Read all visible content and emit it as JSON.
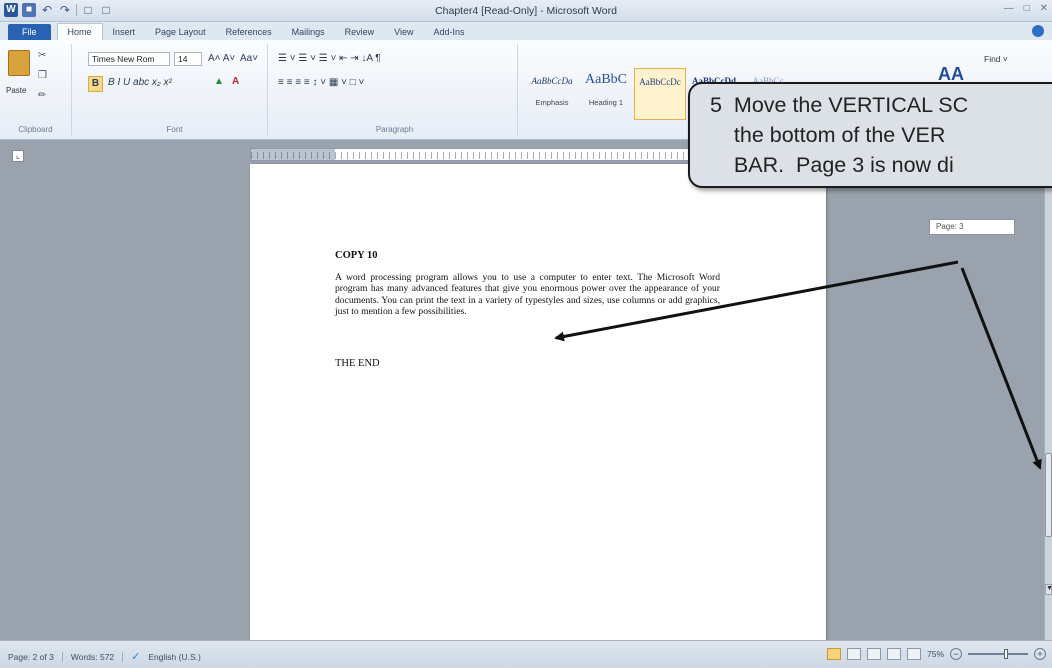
{
  "window": {
    "title": "Chapter4 [Read-Only] - Microsoft Word",
    "qat_icons": [
      "word-logo-icon",
      "save-icon",
      "undo-icon",
      "redo-icon",
      "new-doc-icon",
      "open-icon"
    ]
  },
  "tabs": [
    "File",
    "Home",
    "Insert",
    "Page Layout",
    "References",
    "Mailings",
    "Review",
    "View",
    "Add-Ins"
  ],
  "ribbon": {
    "clipboard": {
      "paste": "Paste",
      "label": "Clipboard"
    },
    "font": {
      "name": "Times New Rom",
      "size": "14",
      "grow": "A˄ A˅",
      "case": "Aa˅",
      "format_row": "B  I  U  abc  x₂  x²",
      "label": "Font"
    },
    "paragraph": {
      "row1": "☰ ˅  ☰ ˅  ☰ ˅   ⇤ ⇥   ↓A   ¶",
      "row2": "≡  ≡  ≡  ≡   ↕ ˅   ▦ ˅   □ ˅",
      "label": "Paragraph"
    },
    "styles": [
      {
        "sample": "AaBbCcDa",
        "name": "Emphasis"
      },
      {
        "sample": "AaBbC",
        "name": "Heading 1"
      },
      {
        "sample": "AaBbCcDc",
        "name": ""
      },
      {
        "sample": "AaBbCcDd",
        "name": ""
      },
      {
        "sample": "AaBbCc",
        "name": ""
      }
    ],
    "find": "Find ˅"
  },
  "document": {
    "heading": "COPY 10",
    "paragraph": "A word processing program allows you to use a computer to enter text. The Microsoft Word program has many advanced features that give you enormous power over the appearance of your documents. You can print the text in a variety of typestyles and sizes, use columns or add graphics, just to mention a few possibilities.",
    "end": "THE END"
  },
  "tooltip": {
    "page": "Page: 3"
  },
  "callout": {
    "text": "5  Move the VERTICAL SC\n    the bottom of the VER\n    BAR.  Page 3 is now di"
  },
  "status": {
    "page": "Page: 2 of 3",
    "words": "Words: 572",
    "language": "English (U.S.)",
    "zoom": "75%"
  }
}
